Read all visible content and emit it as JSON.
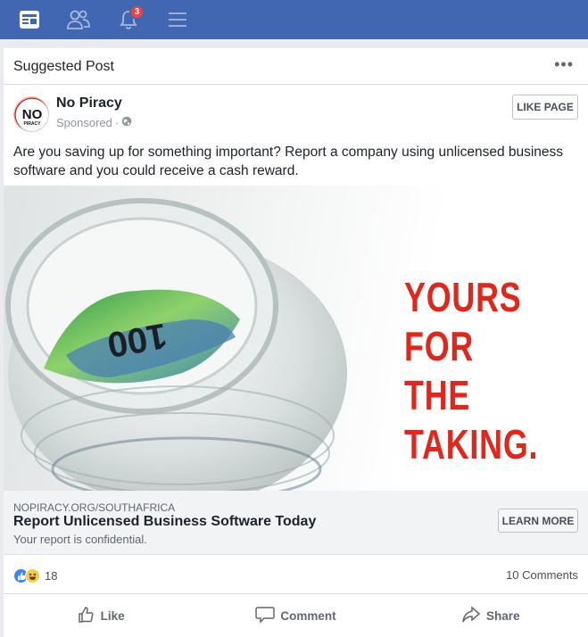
{
  "nav": {
    "items": [
      {
        "icon": "news-feed-icon"
      },
      {
        "icon": "friends-icon"
      },
      {
        "icon": "notifications-bell-icon",
        "badge": "3"
      },
      {
        "icon": "menu-icon"
      }
    ],
    "bar_color": "#4267b2"
  },
  "post": {
    "header_label": "Suggested Post",
    "more_label": "•••",
    "page_logo_text": "NO",
    "page_logo_subtext": "PIRACY",
    "page_name": "No Piracy",
    "sponsored_label": "Sponsored",
    "sponsored_separator": "·",
    "like_page_label": "LIKE PAGE",
    "text": "Are you saving up for something important? Report a company using unlicensed business software and you could receive a cash reward.",
    "image": {
      "headline_lines": [
        "YOURS",
        "FOR THE",
        "TAKING."
      ],
      "banknote_text": "100",
      "headline_color": "#e1261c"
    },
    "link": {
      "domain": "NOPIRACY.ORG/SOUTHAFRICA",
      "title": "Report Unlicensed Business Software Today",
      "description": "Your report is confidential.",
      "cta_label": "LEARN MORE"
    },
    "stats": {
      "reactions": [
        "like-reaction-icon",
        "haha-reaction-icon"
      ],
      "reaction_count": "18",
      "comments": "10 Comments"
    },
    "actions": [
      {
        "label": "Like",
        "icon": "thumbs-up-icon"
      },
      {
        "label": "Comment",
        "icon": "comment-bubble-icon"
      },
      {
        "label": "Share",
        "icon": "share-arrow-icon"
      }
    ]
  }
}
